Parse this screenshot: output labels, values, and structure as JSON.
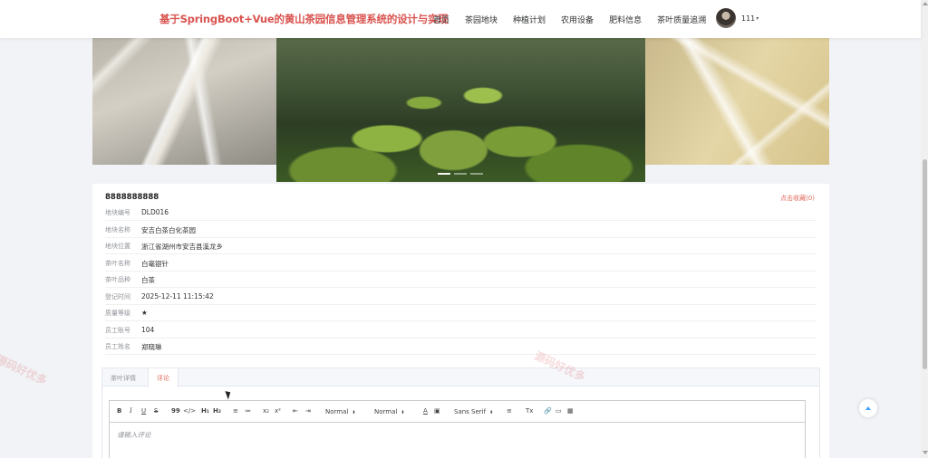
{
  "header": {
    "site_title": "基于SpringBoot+Vue的黄山茶园信息管理系统的设计与实现",
    "nav": [
      "首页",
      "茶园地块",
      "种植计划",
      "农用设备",
      "肥料信息",
      "茶叶质量追溯"
    ],
    "user_name": "111",
    "user_caret": "▾"
  },
  "banner": {
    "slides": [
      "pampas-grass-left",
      "tea-leaves-center",
      "pampas-grass-right"
    ],
    "active_dot": 0,
    "dot_count": 3
  },
  "detail": {
    "record_title": "8888888888",
    "collect_label": "点击收藏(0)",
    "fields": [
      {
        "label": "地块编号",
        "value": "DLD016"
      },
      {
        "label": "地块名称",
        "value": "安吉白茶白化茶园"
      },
      {
        "label": "地块位置",
        "value": "浙江省湖州市安吉县溪龙乡"
      },
      {
        "label": "茶叶名称",
        "value": "白毫银针"
      },
      {
        "label": "茶叶品种",
        "value": "白茶"
      },
      {
        "label": "登记时间",
        "value": "2025-12-11 11:15:42"
      },
      {
        "label": "质量等级",
        "value": "★"
      },
      {
        "label": "员工账号",
        "value": "104"
      },
      {
        "label": "员工姓名",
        "value": "郑晓琳"
      }
    ]
  },
  "tabs": {
    "items": [
      "茶叶详情",
      "评论"
    ],
    "active": "评论"
  },
  "editor": {
    "toolbar": {
      "bold": "B",
      "italic": "I",
      "underline": "U",
      "strike": "S",
      "blockquote": "99",
      "code": "</>",
      "h1": "H₁",
      "h2": "H₂",
      "ordered_list": "≡",
      "bullet_list": "≔",
      "subscript": "x₂",
      "superscript": "x²",
      "outdent": "⇤",
      "indent": "⇥",
      "size": "Normal",
      "header": "Normal",
      "color": "A",
      "background": "▣",
      "font": "Sans Serif",
      "align": "≡",
      "clean": "Tx",
      "link": "🔗",
      "image": "▭",
      "video": "▦"
    },
    "placeholder": "请输入评论"
  },
  "watermark": "源码好优多",
  "colors": {
    "accent": "#e06b5b",
    "title": "#d9534f",
    "back_top_arrow": "#409eff"
  }
}
